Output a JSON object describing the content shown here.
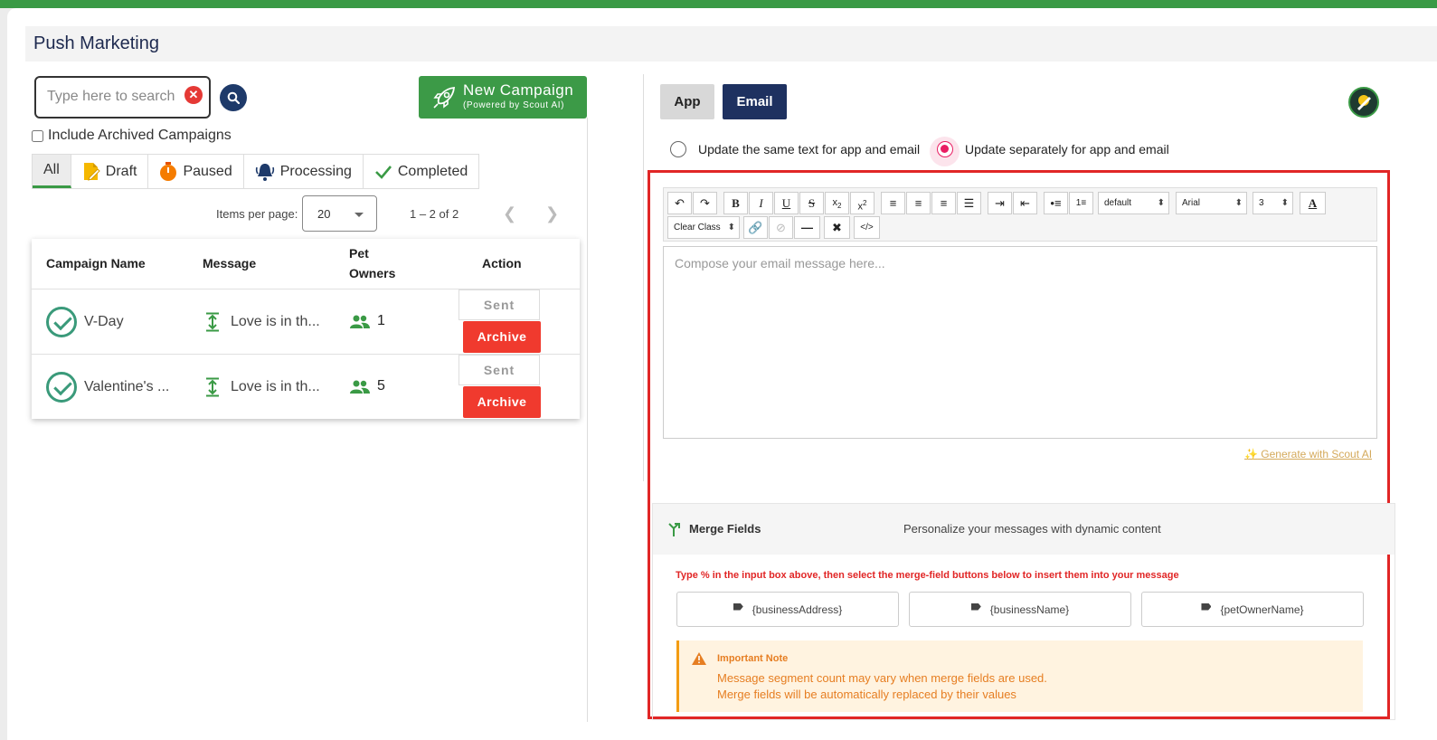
{
  "page_title": "Push Marketing",
  "search": {
    "placeholder": "Type here to search"
  },
  "new_campaign": {
    "label": "New Campaign",
    "sublabel": "(Powered by Scout AI)"
  },
  "include_archived": {
    "label": "Include Archived Campaigns",
    "checked": false
  },
  "filters": [
    {
      "label": "All",
      "active": true
    },
    {
      "label": "Draft",
      "icon": "draft-icon"
    },
    {
      "label": "Paused",
      "icon": "timer-icon"
    },
    {
      "label": "Processing",
      "icon": "bell-icon"
    },
    {
      "label": "Completed",
      "icon": "check-icon"
    }
  ],
  "pagination": {
    "items_label": "Items per page:",
    "page_size": "20",
    "range": "1 – 2 of 2"
  },
  "table": {
    "headers": {
      "name": "Campaign Name",
      "message": "Message",
      "pet_owners_1": "Pet",
      "pet_owners_2": "Owners",
      "action": "Action"
    },
    "rows": [
      {
        "name": "V-Day",
        "message": "Love is in th...",
        "owners": "1",
        "status": "Sent",
        "archive": "Archive"
      },
      {
        "name": "Valentine's ...",
        "message": "Love is in th...",
        "owners": "5",
        "status": "Sent",
        "archive": "Archive"
      }
    ]
  },
  "channel_tabs": {
    "app": "App",
    "email": "Email",
    "active": "Email"
  },
  "update_mode": {
    "same": "Update the same text for app and email",
    "separate": "Update separately for app and email",
    "selected": "separate"
  },
  "editor": {
    "toolbar": {
      "format": "default",
      "font": "Arial",
      "size": "3",
      "clear_class": "Clear Class"
    },
    "placeholder": "Compose your email message here...",
    "generate": "Generate with Scout AI"
  },
  "merge_fields": {
    "title": "Merge Fields",
    "description": "Personalize your messages with dynamic content",
    "hint": "Type % in the input box above, then select the merge-field buttons below to insert them into your message",
    "fields": [
      "{businessAddress}",
      "{businessName}",
      "{petOwnerName}"
    ]
  },
  "note": {
    "title": "Important Note",
    "line1": "Message segment count may vary when merge fields are used.",
    "line2": "Merge fields will be automatically replaced by their values"
  },
  "colors": {
    "brand_green": "#3a9a45",
    "navy": "#1e3160",
    "danger": "#f03a2e",
    "highlight": "#e12626"
  }
}
